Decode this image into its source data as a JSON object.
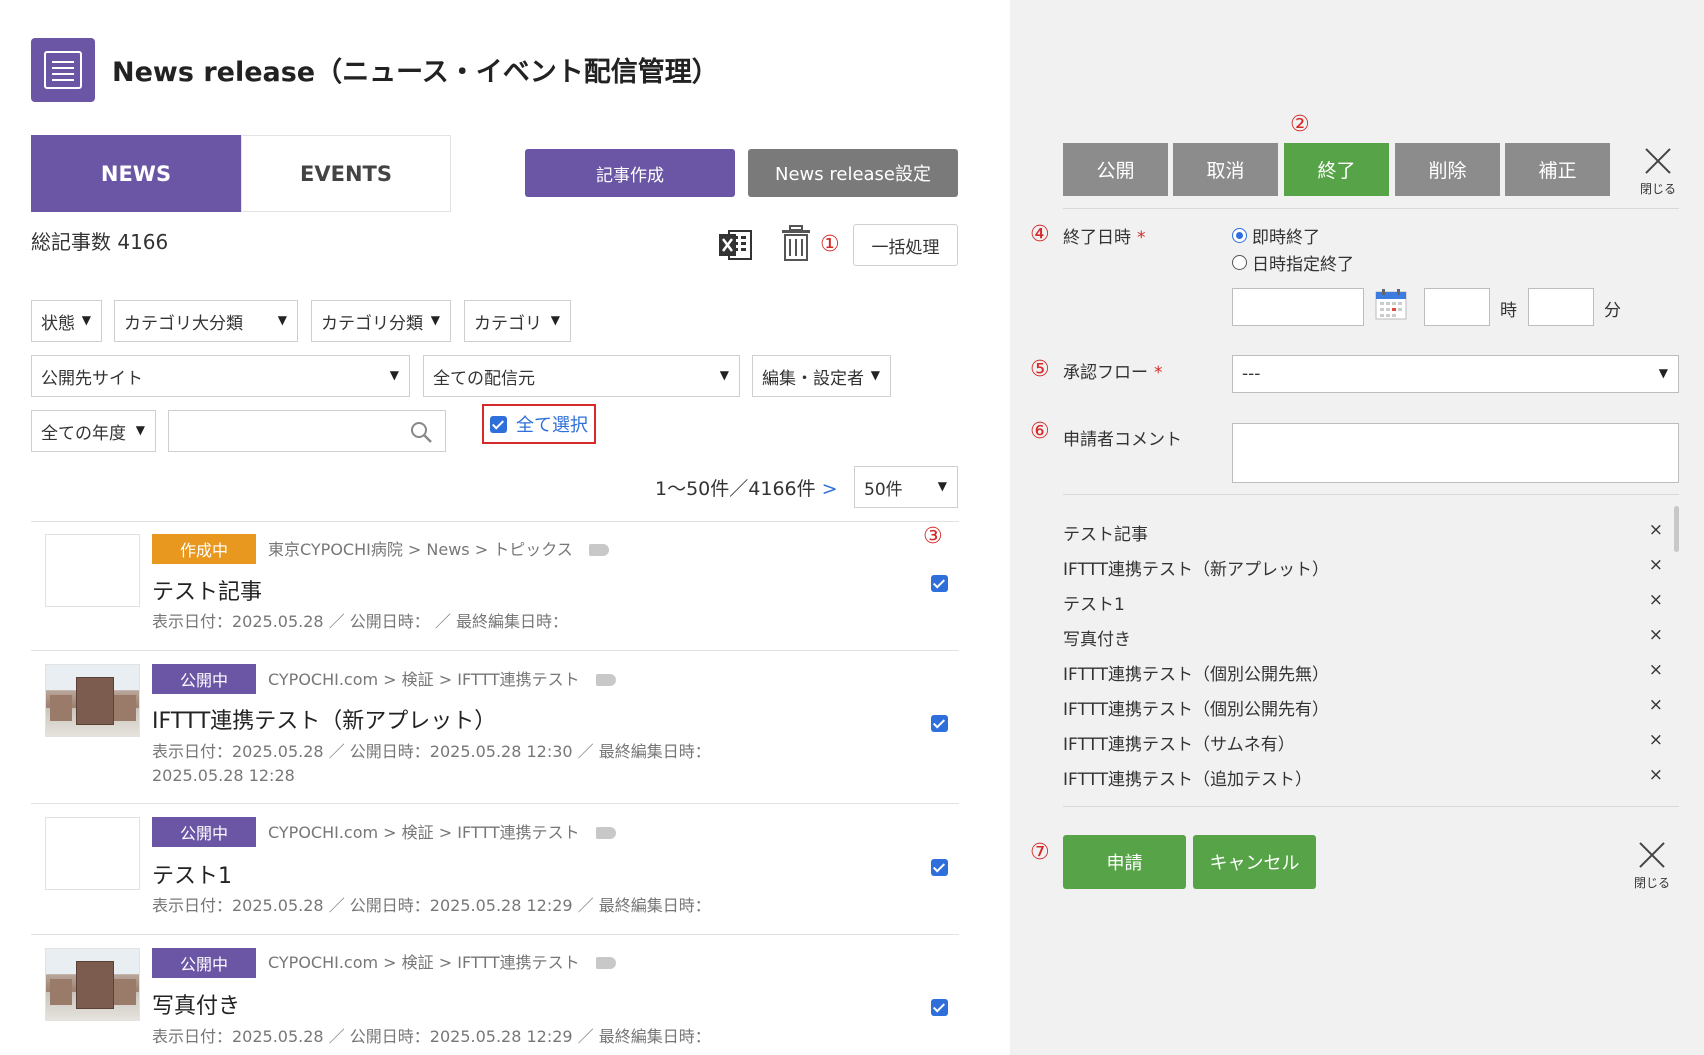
{
  "page": {
    "title": "News release（ニュース・イベント配信管理）",
    "tabs": [
      {
        "label": "NEWS"
      },
      {
        "label": "EVENTS"
      }
    ],
    "create_button": "記事作成",
    "settings_button": "News release設定",
    "total_label": "総記事数 4166",
    "bulk_button": "一括処理",
    "marker_1": "①",
    "marker_3": "③"
  },
  "filters": {
    "status": "状態",
    "major_category": "カテゴリ大分類",
    "category_class": "カテゴリ分類",
    "category": "カテゴリ",
    "site": "公開先サイト",
    "source": "全ての配信元",
    "editor": "編集・設定者",
    "year": "全ての年度",
    "search_value": "",
    "select_all_label": "全て選択",
    "select_all_checked": true
  },
  "pagination": {
    "range": "1〜50件／4166件",
    "next": ">",
    "per_page": "50件"
  },
  "articles": [
    {
      "status": "作成中",
      "status_color": "#e8981e",
      "breadcrumb": "東京CYPOCHI病院 > News > トピックス",
      "title": "テスト記事",
      "meta": "表示日付：2025.05.28 ／ 公開日時： ／ 最終編集日時：",
      "has_thumbnail": false,
      "checked": true
    },
    {
      "status": "公開中",
      "status_color": "#6b55a5",
      "breadcrumb": "CYPOCHI.com > 検証 > IFTTT連携テスト",
      "title": "IFTTT連携テスト（新アプレット）",
      "meta": "表示日付：2025.05.28 ／ 公開日時：2025.05.28 12:30 ／ 最終編集日時：2025.05.28 12:28",
      "has_thumbnail": true,
      "checked": true
    },
    {
      "status": "公開中",
      "status_color": "#6b55a5",
      "breadcrumb": "CYPOCHI.com > 検証 > IFTTT連携テスト",
      "title": "テスト1",
      "meta": "表示日付：2025.05.28 ／ 公開日時：2025.05.28 12:29 ／ 最終編集日時：",
      "has_thumbnail": false,
      "checked": true
    },
    {
      "status": "公開中",
      "status_color": "#6b55a5",
      "breadcrumb": "CYPOCHI.com > 検証 > IFTTT連携テスト",
      "title": "写真付き",
      "meta": "表示日付：2025.05.28 ／ 公開日時：2025.05.28 12:29 ／ 最終編集日時：",
      "has_thumbnail": true,
      "checked": true
    }
  ],
  "panel": {
    "marker_2": "②",
    "actions": [
      {
        "label": "公開",
        "color": "#8c8c8c"
      },
      {
        "label": "取消",
        "color": "#8c8c8c"
      },
      {
        "label": "終了",
        "color": "#56a447"
      },
      {
        "label": "削除",
        "color": "#8c8c8c"
      },
      {
        "label": "補正",
        "color": "#8c8c8c"
      }
    ],
    "close_label": "閉じる",
    "end_datetime": {
      "marker": "④",
      "label": "終了日時",
      "required": "*",
      "options": [
        "即時終了",
        "日時指定終了"
      ],
      "selected": "即時終了",
      "date_value": "",
      "hour_value": "",
      "hour_unit": "時",
      "minute_value": "",
      "minute_unit": "分"
    },
    "approval_flow": {
      "marker": "⑤",
      "label": "承認フロー",
      "required": "*",
      "value": "---"
    },
    "comment": {
      "marker": "⑥",
      "label": "申請者コメント",
      "value": ""
    },
    "selected_items": [
      "テスト記事",
      "IFTTT連携テスト（新アプレット）",
      "テスト1",
      "写真付き",
      "IFTTT連携テスト（個別公開先無）",
      "IFTTT連携テスト（個別公開先有）",
      "IFTTT連携テスト（サムネ有）",
      "IFTTT連携テスト（追加テスト）"
    ],
    "remove_glyph": "×",
    "marker_7": "⑦",
    "apply_button": "申請",
    "cancel_button": "キャンセル"
  },
  "colors": {
    "brand_purple": "#6b55a5",
    "action_gray": "#8c8c8c",
    "action_green": "#56a447",
    "draft_orange": "#e8981e",
    "marker_red": "#d62a2a",
    "link_blue": "#2f6fdb"
  },
  "icons": [
    "news-app-icon",
    "excel-icon",
    "trash-icon",
    "search-icon",
    "tag-icon",
    "calendar-icon",
    "close-icon",
    "chevron-down-icon",
    "next-arrow-icon"
  ]
}
